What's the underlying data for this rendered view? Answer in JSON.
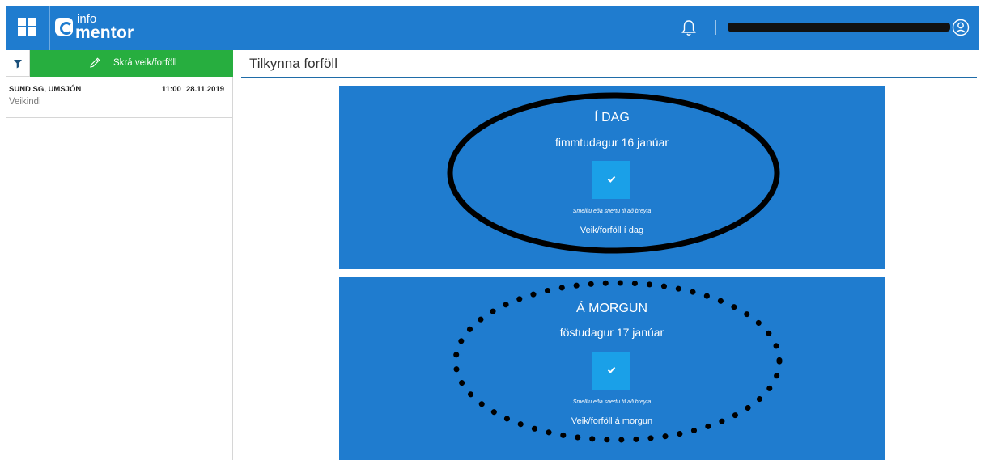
{
  "header": {
    "logo_top": "info",
    "logo_bottom": "mentor",
    "icons": {
      "apps": "grid-icon",
      "notifications": "bell-icon",
      "user": "user-circle-icon"
    }
  },
  "sidebar": {
    "report_button_label": "Skrá veik/forföll",
    "items": [
      {
        "title": "SUND SG, UMSJÓN",
        "time": "11:00",
        "date": "28.11.2019",
        "subtitle": "Veikindi"
      }
    ]
  },
  "main": {
    "title": "Tilkynna forföll",
    "days": [
      {
        "heading": "Í DAG",
        "date": "fimmtudagur 16 janúar",
        "hint": "Smelltu eða snertu til að breyta",
        "status": "Veik/forföll í dag"
      },
      {
        "heading": "Á MORGUN",
        "date": "föstudagur 17 janúar",
        "hint": "Smelltu eða snertu til að breyta",
        "status": "Veik/forföll á morgun"
      }
    ]
  },
  "colors": {
    "header_blue": "#1f7ccf",
    "card_blue": "#1f7ccf",
    "toggle_blue": "#1aa0e8",
    "report_green": "#27ae3f",
    "rule_blue": "#1f6ca8"
  }
}
